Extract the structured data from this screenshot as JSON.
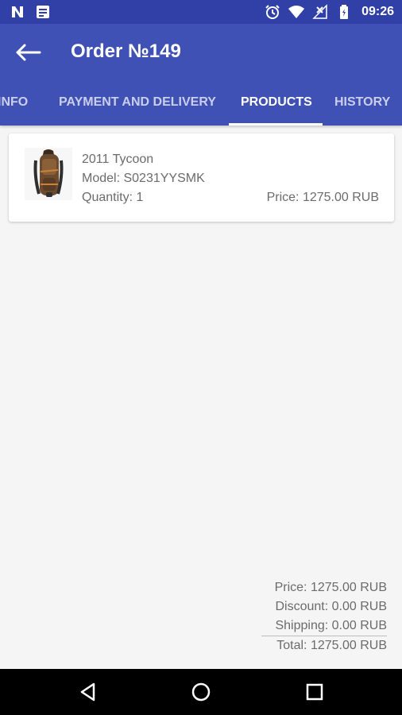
{
  "status_bar": {
    "time": "09:26",
    "left_icons": [
      "n-notification-icon",
      "message-notification-icon"
    ],
    "right_icons": [
      "alarm-icon",
      "wifi-icon",
      "no-signal-icon",
      "battery-icon"
    ]
  },
  "app_bar": {
    "back_icon": "arrow-back-icon",
    "title": "Order №149"
  },
  "tabs": [
    {
      "label": "INFO",
      "active": false
    },
    {
      "label": "PAYMENT AND DELIVERY",
      "active": false
    },
    {
      "label": "PRODUCTS",
      "active": true
    },
    {
      "label": "HISTORY",
      "active": false
    }
  ],
  "product": {
    "image": "backpack-image",
    "name": "2011 Tycoon",
    "model": "Model: S0231YYSMK",
    "quantity": "Quantity: 1",
    "price": "Price: 1275.00 RUB"
  },
  "totals": {
    "price": "Price: 1275.00 RUB",
    "discount": "Discount: 0.00 RUB",
    "shipping": "Shipping: 0.00 RUB",
    "total": "Total: 1275.00 RUB"
  },
  "nav_bar": {
    "icons": [
      "back-triangle-icon",
      "home-circle-icon",
      "recents-square-icon"
    ]
  },
  "colors": {
    "primary": "#3f51b5",
    "primary_dark": "#3040a6",
    "background": "#f5f5f5",
    "text_secondary": "#6b6b6b"
  }
}
